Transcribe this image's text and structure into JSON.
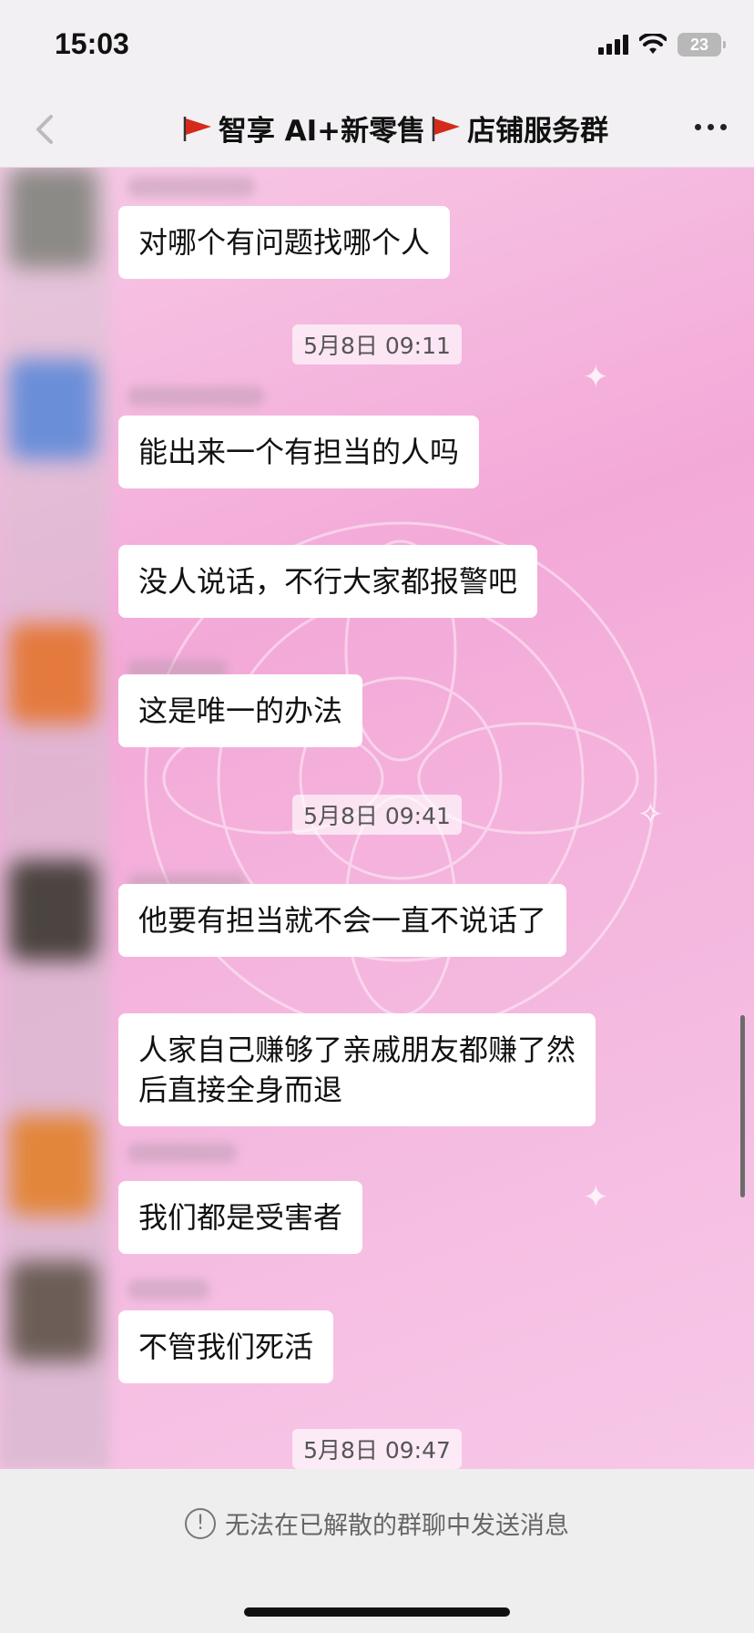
{
  "status_bar": {
    "time": "15:03",
    "battery": "23",
    "icons": [
      "signal-icon",
      "wifi-icon",
      "battery-icon"
    ]
  },
  "header": {
    "title_part1": "智享 AI+新零售",
    "title_part2": "店铺服务群",
    "back_icon": "chevron-left-icon",
    "more_icon": "more-dots-icon",
    "flag_color": "#d42a1c"
  },
  "messages": [
    {
      "type": "text",
      "text": "对哪个有问题找哪个人"
    },
    {
      "type": "time",
      "text": "5月8日 09:11"
    },
    {
      "type": "text",
      "text": "能出来一个有担当的人吗"
    },
    {
      "type": "text",
      "text": "没人说话，不行大家都报警吧"
    },
    {
      "type": "text",
      "text": "这是唯一的办法"
    },
    {
      "type": "time",
      "text": "5月8日 09:41"
    },
    {
      "type": "text",
      "text": "他要有担当就不会一直不说话了"
    },
    {
      "type": "text",
      "text": "人家自己赚够了亲戚朋友都赚了然\n后直接全身而退"
    },
    {
      "type": "text",
      "text": "我们都是受害者"
    },
    {
      "type": "text",
      "text": "不管我们死活"
    },
    {
      "type": "time",
      "text": "5月8日 09:47"
    }
  ],
  "footer": {
    "notice": "无法在已解散的群聊中发送消息",
    "icon": "info-circle-icon"
  },
  "colors": {
    "chat_background": "#f3a9d8",
    "bubble": "#ffffff",
    "footer_bg": "#eeeeee"
  }
}
